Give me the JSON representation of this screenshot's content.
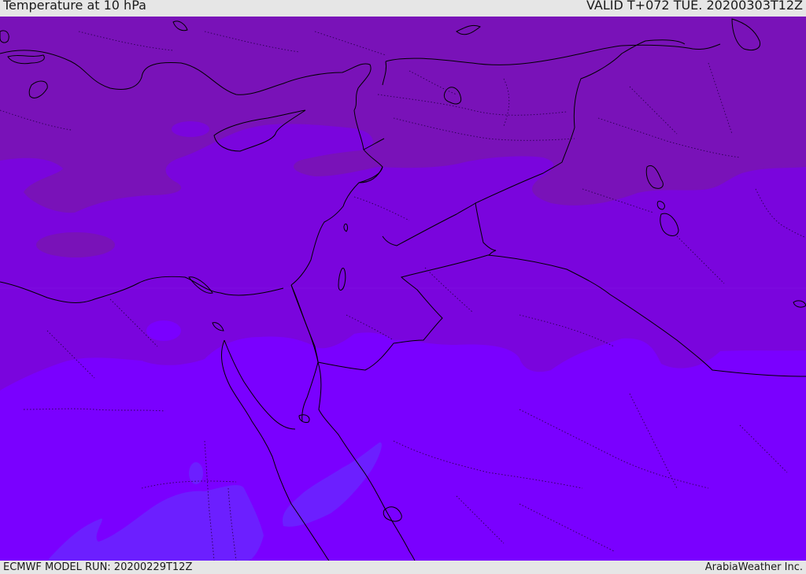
{
  "header": {
    "title": "Temperature at 10 hPa",
    "valid_time": "VALID T+072 TUE. 20200303T12Z"
  },
  "footer": {
    "model_run": "ECMWF MODEL RUN: 20200229T12Z",
    "credit": "ArabiaWeather Inc."
  },
  "colors": {
    "band_north": "#7912b8",
    "band_middle": "#7a05dd",
    "band_south": "#7a00ff",
    "band_southwest": "#6c1fff",
    "coastline": "#000000",
    "border_solid": "#000000",
    "border_dotted": "#3a0060",
    "bar_background": "#e6e6e6"
  }
}
